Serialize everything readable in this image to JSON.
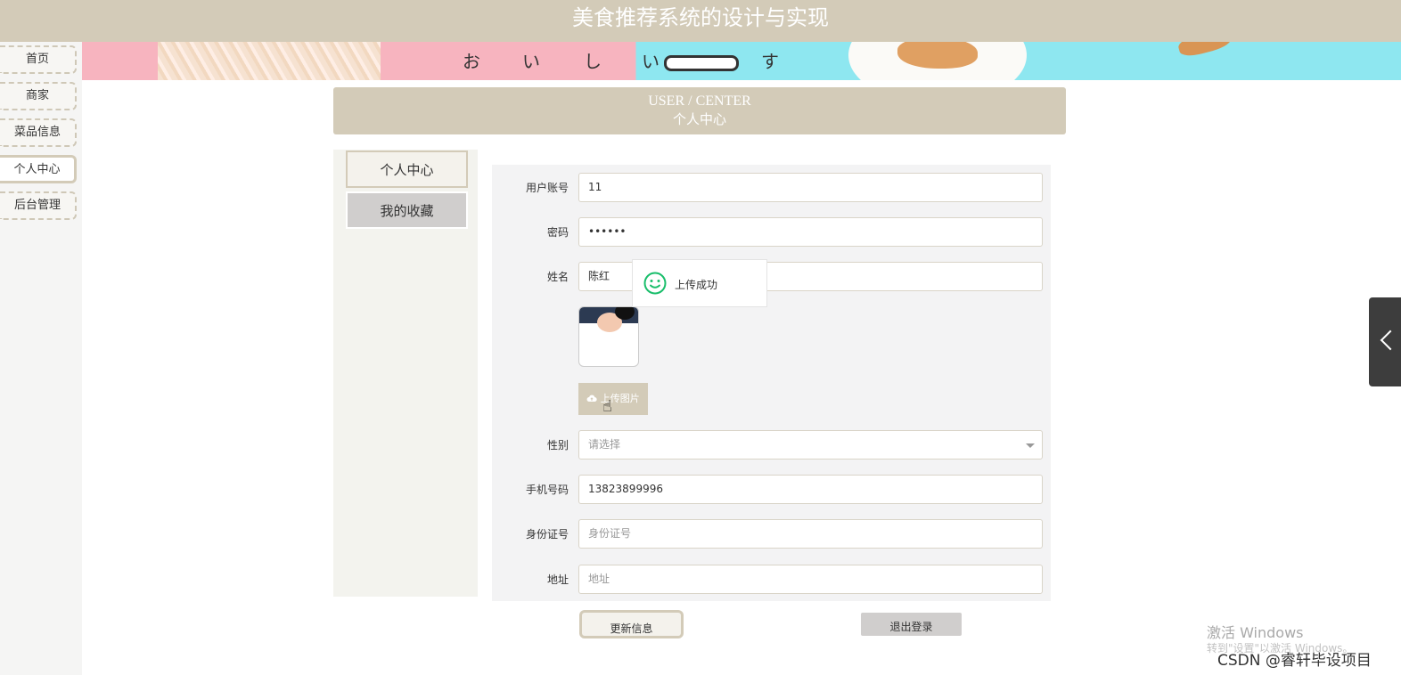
{
  "header": {
    "title": "美食推荐系统的设计与实现"
  },
  "sidebar": {
    "items": [
      {
        "label": "首页"
      },
      {
        "label": "商家"
      },
      {
        "label": "菜品信息"
      },
      {
        "label": "个人中心",
        "active": true
      },
      {
        "label": "后台管理"
      }
    ]
  },
  "banner": {
    "kana": [
      "お",
      "い",
      "し",
      "い",
      "す"
    ]
  },
  "user_center": {
    "title_en": "USER / CENTER",
    "title_cn": "个人中心"
  },
  "tabs": [
    {
      "label": "个人中心",
      "active": true
    },
    {
      "label": "我的收藏"
    }
  ],
  "form": {
    "account_label": "用户账号",
    "account_value": "11",
    "password_label": "密码",
    "password_value": "••••••",
    "name_label": "姓名",
    "name_value": "陈红",
    "upload_label": "上传图片",
    "gender_label": "性别",
    "gender_placeholder": "请选择",
    "phone_label": "手机号码",
    "phone_value": "13823899996",
    "id_label": "身份证号",
    "id_placeholder": "身份证号",
    "address_label": "地址",
    "address_placeholder": "地址"
  },
  "toast": {
    "message": "上传成功"
  },
  "buttons": {
    "update": "更新信息",
    "logout": "退出登录"
  },
  "watermarks": {
    "windows_line1": "激活 Windows",
    "windows_line2": "转到\"设置\"以激活 Windows。",
    "csdn": "CSDN @睿轩毕设项目"
  },
  "colors": {
    "accent": "#d3cbb8",
    "success": "#19be6b"
  }
}
